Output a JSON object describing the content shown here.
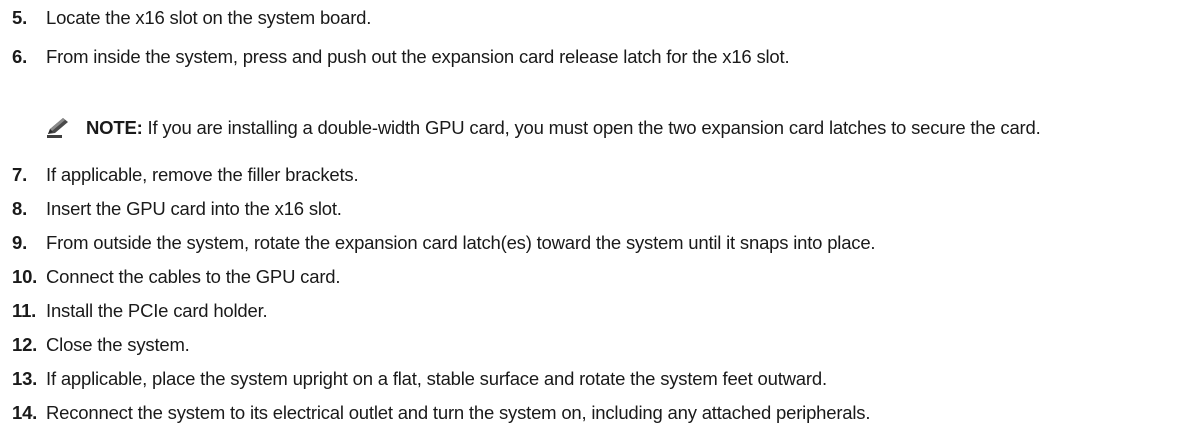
{
  "steps_before_note": [
    {
      "number": "5.",
      "text": "Locate the x16 slot on the system board."
    },
    {
      "number": "6.",
      "text": "From inside the system, press and push out the expansion card release latch for the x16 slot."
    }
  ],
  "note": {
    "icon": "pencil-note-icon",
    "label": "NOTE:",
    "text": " If you are installing a double-width GPU card, you must open the two expansion card latches to secure the card."
  },
  "steps_after_note": [
    {
      "number": "7.",
      "text": "If applicable, remove the filler brackets."
    },
    {
      "number": "8.",
      "text": "Insert the GPU card into the x16 slot."
    },
    {
      "number": "9.",
      "text": "From outside the system, rotate the expansion card latch(es) toward the system until it snaps into place."
    },
    {
      "number": "10.",
      "text": "Connect the cables to the GPU card."
    },
    {
      "number": "11.",
      "text": "Install the PCIe card holder."
    },
    {
      "number": "12.",
      "text": "Close the system."
    },
    {
      "number": "13.",
      "text": "If applicable, place the system upright on a flat, stable surface and rotate the system feet outward."
    },
    {
      "number": "14.",
      "text": "Reconnect the system to its electrical outlet and turn the system on, including any attached peripherals."
    }
  ]
}
